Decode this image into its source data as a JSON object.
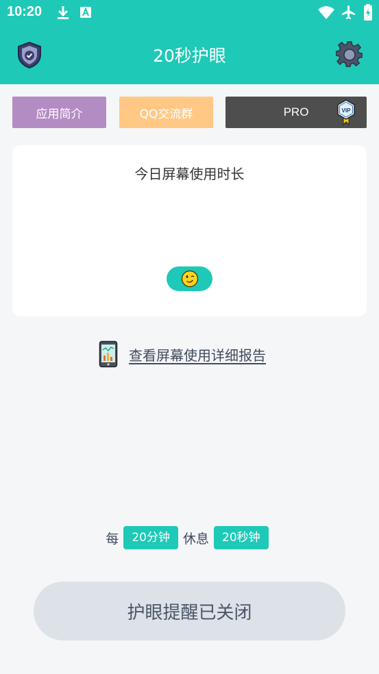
{
  "status_bar": {
    "time": "10:20",
    "left_icons": [
      "download-icon",
      "font-a-icon"
    ],
    "right_icons": [
      "wifi-icon",
      "airplane-icon",
      "battery-icon"
    ]
  },
  "app_bar": {
    "title": "20秒护眼",
    "left_icon": "shield-check-icon",
    "right_icon": "gear-icon"
  },
  "tabs": {
    "intro": "应用简介",
    "qq": "QQ交流群",
    "pro": "PRO"
  },
  "screen_time_card": {
    "title": "今日屏幕使用时长",
    "indicator_icon": "wink-smile-icon"
  },
  "report_link": "查看屏幕使用详细报告",
  "schedule": {
    "every": "每",
    "interval": "20分钟",
    "rest": "休息",
    "duration": "20秒钟"
  },
  "main_toggle": "护眼提醒已关闭",
  "colors": {
    "accent": "#1ec9b7",
    "intro_button": "#b48cc4",
    "qq_button": "#ffc985",
    "pro_button": "#4e4e4e",
    "toggle_off": "#dde2e8"
  }
}
